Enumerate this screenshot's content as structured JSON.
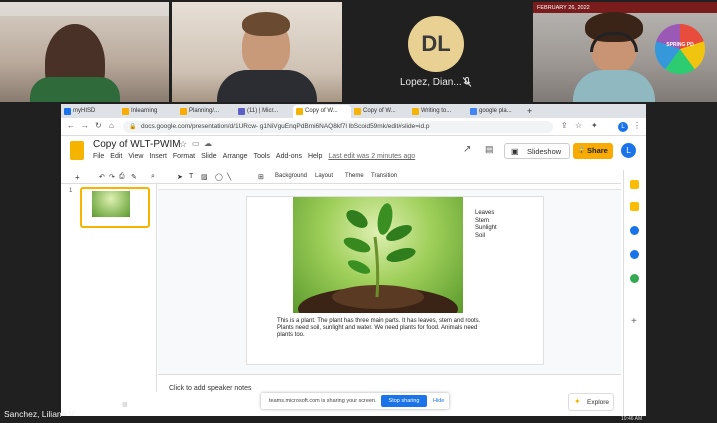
{
  "participants": {
    "tile4_banner": "FEBRUARY 26, 2022",
    "tile4_logo_text": "SPRING PD",
    "lopez": {
      "initials": "DL",
      "name": "Lopez, Dian..."
    },
    "sanchez": {
      "name": "Sanchez, Liliana V"
    }
  },
  "browser": {
    "tabs": [
      {
        "label": "myHISD",
        "color": "#1a73e8"
      },
      {
        "label": "Inlearning",
        "color": "#f9ab00"
      },
      {
        "label": "Planning/...",
        "color": "#f9ab00"
      },
      {
        "label": "(11) | Micr...",
        "color": "#5b5fc7"
      },
      {
        "label": "Copy of W...",
        "color": "#f4b400"
      },
      {
        "label": "Copy of W...",
        "color": "#f4b400"
      },
      {
        "label": "Writing to...",
        "color": "#f4b400"
      },
      {
        "label": "google pla...",
        "color": "#4285f4"
      }
    ],
    "url": "docs.google.com/presentation/d/1URcw- g1NiVguEnqPdBmi6NAQ8kf7l lbScoid59mk/edit#slide=id.p"
  },
  "slides_app": {
    "title": "Copy of WLT-PWIM",
    "menu": [
      "File",
      "Edit",
      "View",
      "Insert",
      "Format",
      "Slide",
      "Arrange",
      "Tools",
      "Add-ons",
      "Help"
    ],
    "last_edit": "Last edit was 2 minutes ago",
    "slideshow_label": "Slideshow",
    "share_label": "Share",
    "avatar_initial": "L",
    "toolbar": {
      "background": "Background",
      "layout": "Layout",
      "theme": "Theme",
      "transition": "Transition"
    },
    "thumb_number": "1",
    "slide": {
      "words": [
        "Leaves",
        "Stem",
        "Sunlight",
        "Soil"
      ],
      "caption": "This is a plant. The plant has three main parts. It has leaves, stem and roots. Plants need soil, sunlight and water. We need plants for food. Animals need plants too."
    },
    "notes_placeholder": "Click to add speaker notes",
    "explore_label": "Explore"
  },
  "share_banner": {
    "text": "teams.microsoft.com is sharing your screen.",
    "stop_label": "Stop sharing",
    "hide_label": "Hide"
  },
  "taskbar": {
    "time": "10:46 AM"
  }
}
